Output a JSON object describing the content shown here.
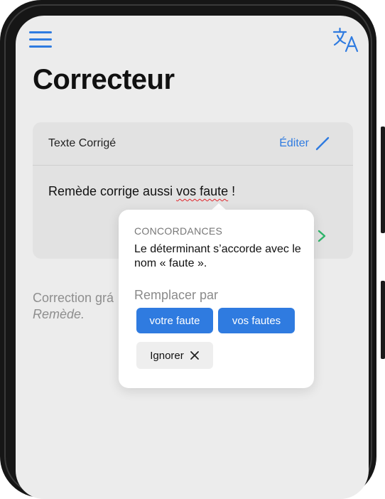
{
  "app": {
    "title": "Correcteur",
    "accent_color": "#2f7be0",
    "error_color": "#e0252b"
  },
  "toolbar": {
    "menu_icon": "hamburger-menu-icon",
    "translate_icon": "translate-icon"
  },
  "card": {
    "label": "Texte Corrigé",
    "edit_label": "Éditer",
    "edit_icon": "pencil-icon",
    "text_before": "Remède corrige aussi ",
    "text_error": "vos faute",
    "text_after": " !",
    "next_icon": "chevron-right-icon"
  },
  "footer": {
    "line1": "Correction grá",
    "line2": "Remède."
  },
  "popup": {
    "heading": "CONCORDANCES",
    "message": "Le déterminant s’accorde avec le nom « faute ».",
    "replace_label": "Remplacer par",
    "suggestions": [
      "votre faute",
      "vos fautes"
    ],
    "ignore_label": "Ignorer",
    "ignore_icon": "close-icon"
  }
}
